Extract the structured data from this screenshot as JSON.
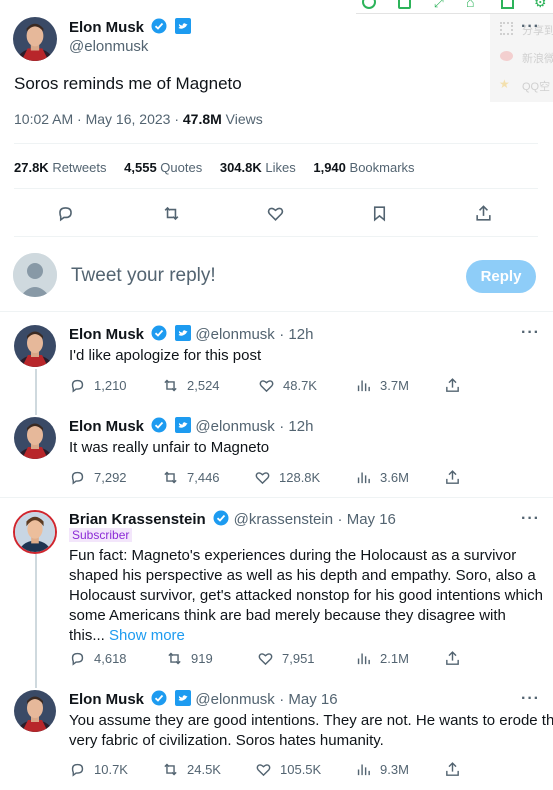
{
  "main_tweet": {
    "name": "Elon Musk",
    "handle": "@elonmusk",
    "text": "Soros reminds me of Magneto",
    "time": "10:02 AM · May 16, 2023 · ",
    "views_count": "47.8M",
    "views_label": " Views",
    "stats": {
      "retweets_count": "27.8K",
      "retweets_label": " Retweets",
      "quotes_count": "4,555",
      "quotes_label": " Quotes",
      "likes_count": "304.8K",
      "likes_label": " Likes",
      "bookmarks_count": "1,940",
      "bookmarks_label": " Bookmarks"
    }
  },
  "reply_box": {
    "placeholder": "Tweet your reply!",
    "button": "Reply"
  },
  "replies": [
    {
      "name": "Elon Musk",
      "handle": "@elonmusk",
      "time": "· 12h",
      "text": "I'd like apologize for this post",
      "replies": "1,210",
      "retweets": "2,524",
      "likes": "48.7K",
      "views": "3.7M"
    },
    {
      "name": "Elon Musk",
      "handle": "@elonmusk",
      "time": "· 12h",
      "text": "It was really unfair to Magneto",
      "replies": "7,292",
      "retweets": "7,446",
      "likes": "128.8K",
      "views": "3.6M"
    },
    {
      "name": "Brian Krassenstein",
      "handle": "@krassenstein",
      "time": "· May 16",
      "subscriber": "Subscriber",
      "text_lines": [
        "Fun fact:  Magneto's experiences during the Holocaust as a survivor",
        "shaped his perspective as well as his depth and empathy.  Soro, also a",
        "Holocaust survivor, get's attacked nonstop for his good intentions which",
        "some Americans think are bad merely because they disagree with",
        "this..."
      ],
      "show_more": "Show more",
      "replies": "4,618",
      "retweets": "919",
      "likes": "7,951",
      "views": "2.1M"
    },
    {
      "name": "Elon Musk",
      "handle": "@elonmusk",
      "time": "· May 16",
      "text_lines": [
        "You assume they are good intentions. They are not. He wants to erode the",
        "very fabric of civilization. Soros hates humanity."
      ],
      "replies": "10.7K",
      "retweets": "24.5K",
      "likes": "105.5K",
      "views": "9.3M"
    }
  ],
  "overlay": {
    "items": [
      "分享到",
      "新浪微",
      "QQ空"
    ]
  },
  "colors": {
    "accent": "#1d9bf0",
    "text": "#0f1419",
    "muted": "#536471",
    "subscriber": "#8b2bd6",
    "overlay_green": "#2db35a"
  }
}
